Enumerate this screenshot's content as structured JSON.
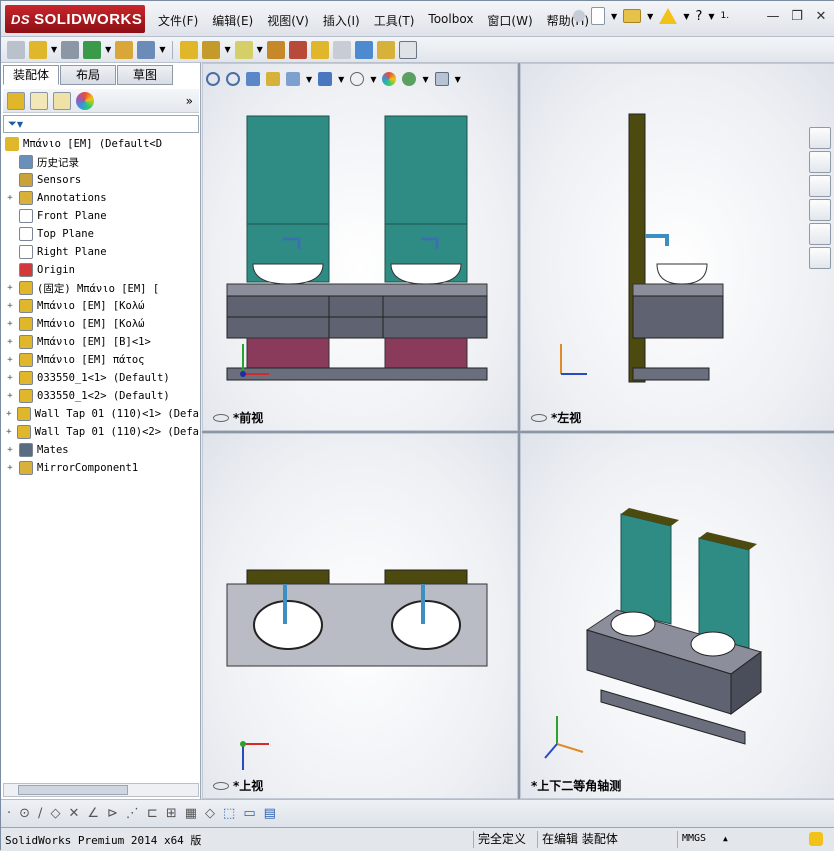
{
  "app": {
    "logo_text": "SOLIDWORKS",
    "logo_prefix": "DS"
  },
  "menu": [
    "文件(F)",
    "编辑(E)",
    "视图(V)",
    "插入(I)",
    "工具(T)",
    "Toolbox",
    "窗口(W)",
    "帮助(H)"
  ],
  "title_right": {
    "help_label": "?",
    "small_label": "1."
  },
  "feature_manager": {
    "tabs": [
      {
        "label": "装配体",
        "active": true
      },
      {
        "label": "布局",
        "active": false
      },
      {
        "label": "草图",
        "active": false
      }
    ],
    "filter_label": "▼",
    "root": "Μπάνιο [EM]   (Default<D",
    "items": [
      {
        "label": "历史记录",
        "expander": "",
        "icon": "history-icon",
        "color": "#6a8fb8"
      },
      {
        "label": "Sensors",
        "expander": "",
        "icon": "sensor-icon",
        "color": "#c9a33a"
      },
      {
        "label": "Annotations",
        "expander": "+",
        "icon": "annotation-icon",
        "color": "#d8b03a"
      },
      {
        "label": "Front Plane",
        "expander": "",
        "icon": "plane-icon",
        "color": "#ffffff"
      },
      {
        "label": "Top Plane",
        "expander": "",
        "icon": "plane-icon",
        "color": "#ffffff"
      },
      {
        "label": "Right Plane",
        "expander": "",
        "icon": "plane-icon",
        "color": "#ffffff"
      },
      {
        "label": "Origin",
        "expander": "",
        "icon": "origin-icon",
        "color": "#d23a3a"
      },
      {
        "label": "(固定) Μπάνιο [EM] [",
        "expander": "+",
        "icon": "assembly-icon",
        "color": "#e0b62a"
      },
      {
        "label": "Μπάνιο [EM] [Κολώ",
        "expander": "+",
        "icon": "assembly-icon",
        "color": "#e0b62a"
      },
      {
        "label": "Μπάνιο [EM] [Κολώ",
        "expander": "+",
        "icon": "assembly-icon",
        "color": "#e0b62a"
      },
      {
        "label": "Μπάνιο [EM] [B]<1>",
        "expander": "+",
        "icon": "assembly-icon",
        "color": "#e0b62a"
      },
      {
        "label": "Μπάνιο [EM] πάτος",
        "expander": "+",
        "icon": "assembly-icon",
        "color": "#e0b62a"
      },
      {
        "label": "033550_1<1> (Default)",
        "expander": "+",
        "icon": "assembly-icon",
        "color": "#e0b62a"
      },
      {
        "label": "033550_1<2> (Default)",
        "expander": "+",
        "icon": "assembly-icon",
        "color": "#e0b62a"
      },
      {
        "label": "Wall Tap 01 (110)<1> (Defa",
        "expander": "+",
        "icon": "assembly-icon",
        "color": "#e0b62a"
      },
      {
        "label": "Wall Tap 01 (110)<2> (Defa",
        "expander": "+",
        "icon": "assembly-icon",
        "color": "#e0b62a"
      },
      {
        "label": "Mates",
        "expander": "+",
        "icon": "mates-icon",
        "color": "#5a6c82"
      },
      {
        "label": "MirrorComponent1",
        "expander": "+",
        "icon": "mirror-icon",
        "color": "#d8b03a"
      }
    ]
  },
  "viewports": [
    {
      "label": "*前视"
    },
    {
      "label": "*左视"
    },
    {
      "label": "*上视"
    },
    {
      "label": "*上下二等角轴测"
    }
  ],
  "axes": {
    "x": "X",
    "y": "Y",
    "z": "Z"
  },
  "colors": {
    "teal": "#2f8c85",
    "counter": "#5f6270",
    "maroon": "#8a3a5a",
    "olive": "#4d4a10",
    "slab": "#6b6e7c",
    "top_gray": "#8c8f9b"
  },
  "statusbar": {
    "product": "SolidWorks Premium 2014 x64 版",
    "state": "完全定义",
    "mode": "在编辑 装配体",
    "units": "MMGS",
    "units_arrow": "▲"
  }
}
